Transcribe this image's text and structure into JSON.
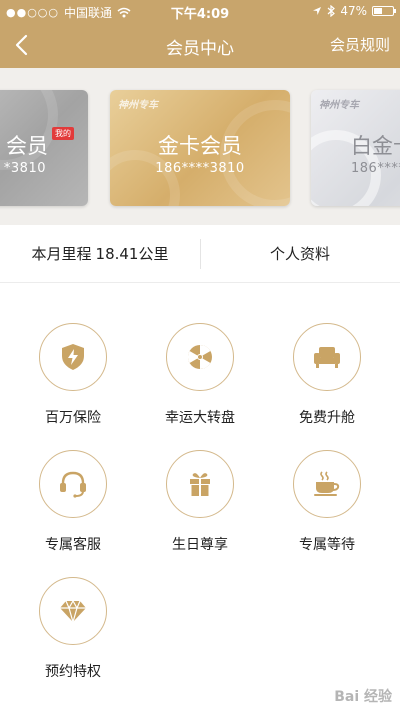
{
  "status_bar": {
    "signal_dots": "●●○○○",
    "carrier": "中国联通",
    "time": "下午4:09",
    "battery_percent": "47%",
    "battery_level": 0.47
  },
  "nav": {
    "title": "会员中心",
    "rules_label": "会员规则"
  },
  "cards": [
    {
      "brand": "",
      "name": "会员",
      "number": "*3810",
      "badge": "我的"
    },
    {
      "brand": "神州专车",
      "name": "金卡会员",
      "number": "186****3810"
    },
    {
      "brand": "神州专车",
      "name": "白金卡",
      "number": "186****"
    }
  ],
  "info": {
    "mileage_label": "本月里程",
    "mileage_value": "18.41公里",
    "profile_label": "个人资料"
  },
  "benefits": [
    {
      "label": "百万保险",
      "icon": "shield-bolt-icon"
    },
    {
      "label": "幸运大转盘",
      "icon": "wheel-icon"
    },
    {
      "label": "免费升舱",
      "icon": "armchair-icon"
    },
    {
      "label": "专属客服",
      "icon": "headset-icon"
    },
    {
      "label": "生日尊享",
      "icon": "gift-icon"
    },
    {
      "label": "专属等待",
      "icon": "coffee-icon"
    },
    {
      "label": "预约特权",
      "icon": "diamond-icon"
    }
  ],
  "colors": {
    "brand_gold": "#c8a56c",
    "icon_gold": "#c9a465",
    "circle_border": "#d4b98c"
  },
  "watermark": "Bai 经验"
}
